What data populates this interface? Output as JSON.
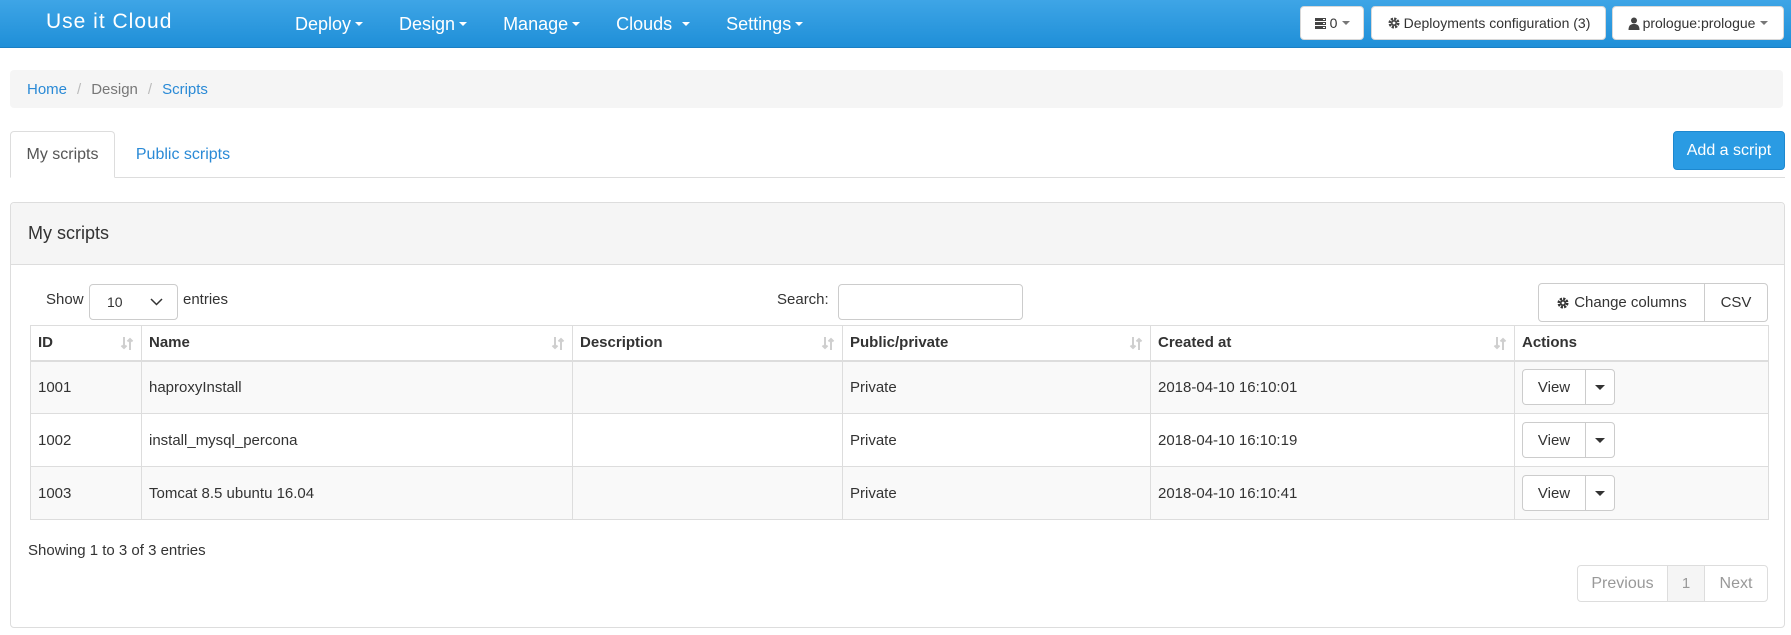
{
  "navbar": {
    "brand": "Use it Cloud",
    "menu": [
      {
        "label": "Deploy"
      },
      {
        "label": "Design"
      },
      {
        "label": "Manage"
      },
      {
        "label": "Clouds"
      },
      {
        "label": "Settings"
      }
    ],
    "server_count": "0",
    "deployments_label": "Deployments configuration (3)",
    "user_label": "prologue:prologue"
  },
  "breadcrumb": {
    "home": "Home",
    "design": "Design",
    "scripts": "Scripts"
  },
  "tabs": {
    "my_scripts": "My scripts",
    "public_scripts": "Public scripts"
  },
  "add_button": "Add a script",
  "panel": {
    "title": "My scripts",
    "show_label": "Show",
    "page_size": "10",
    "entries_label": "entries",
    "search_label": "Search:",
    "search_value": "",
    "change_columns_label": "Change columns",
    "csv_label": "CSV"
  },
  "table": {
    "headers": [
      "ID",
      "Name",
      "Description",
      "Public/private",
      "Created at",
      "Actions"
    ],
    "rows": [
      {
        "id": "1001",
        "name": "haproxyInstall",
        "description": "",
        "visibility": "Private",
        "created_at": "2018-04-10 16:10:01",
        "action": "View"
      },
      {
        "id": "1002",
        "name": "install_mysql_percona",
        "description": "",
        "visibility": "Private",
        "created_at": "2018-04-10 16:10:19",
        "action": "View"
      },
      {
        "id": "1003",
        "name": "Tomcat 8.5 ubuntu 16.04",
        "description": "",
        "visibility": "Private",
        "created_at": "2018-04-10 16:10:41",
        "action": "View"
      }
    ]
  },
  "footer": {
    "info": "Showing 1 to 3 of 3 entries",
    "previous": "Previous",
    "page": "1",
    "next": "Next"
  },
  "colors": {
    "navbar": "#2a9be3",
    "link": "#2a8ad6",
    "primary_button": "#2a9be3"
  },
  "icons": {
    "server": "server-stack-icon",
    "gear": "gear-icon",
    "user": "user-icon",
    "sort": "sort-icon",
    "chevron": "chevron-down-icon"
  }
}
